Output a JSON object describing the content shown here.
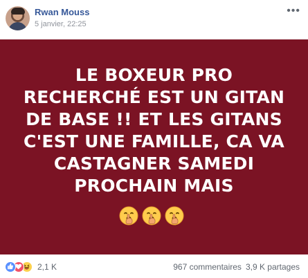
{
  "post": {
    "author": "Rwan Mouss",
    "timestamp": "5 janvier, 22:25",
    "menu_icon": "more-options-icon",
    "content": {
      "lines": [
        "LE BOXEUR PRO",
        "RECHERCHÉ EST UN GITAN",
        "DE BASE !! ET LES GITANS",
        "C'EST UNE FAMILLE, CA VA",
        "CASTAGNER SAMEDI",
        "PROCHAIN MAIS"
      ],
      "emoji_names": [
        "shushing-face-icon",
        "shushing-face-icon",
        "shushing-face-icon"
      ],
      "background_color": "#7b1324",
      "text_color": "#ffffff"
    },
    "footer": {
      "reaction_icons": [
        "like-reaction-icon",
        "love-reaction-icon",
        "haha-reaction-icon"
      ],
      "reaction_count": "2,1 K",
      "comments": "967 commentaires",
      "shares": "3,9 K partages"
    }
  },
  "colors": {
    "author": "#365899",
    "secondary_text": "#90949c",
    "footer_text": "#606770",
    "like": "#5890ff",
    "love": "#f25268",
    "haha": "#fcd14d"
  }
}
